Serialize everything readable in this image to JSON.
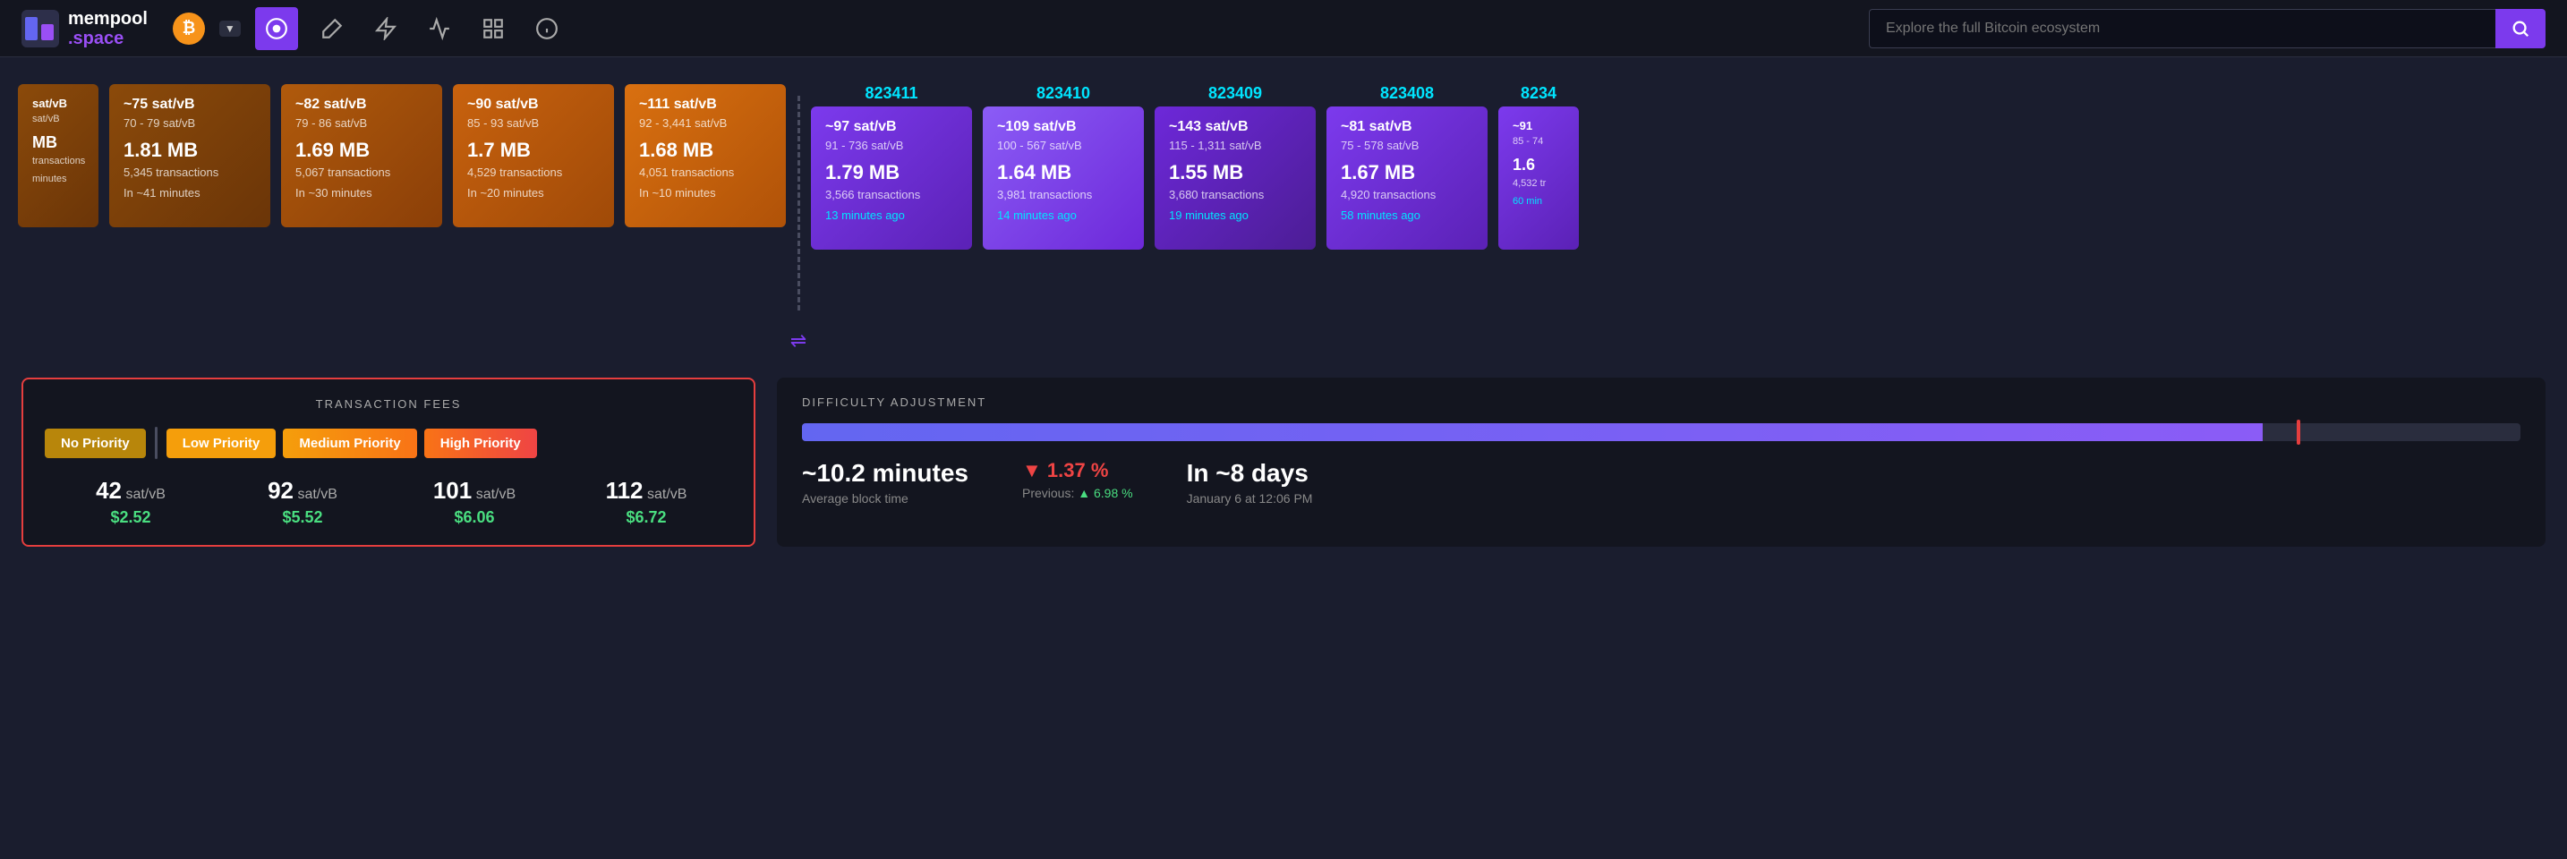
{
  "header": {
    "logo_mempool": "mempool",
    "logo_space": ".space",
    "bitcoin_symbol": "₿",
    "nav_icons": [
      "dashboard",
      "hammer",
      "lightning",
      "chart",
      "layers",
      "info"
    ],
    "search_placeholder": "Explore the full Bitcoin ecosystem",
    "search_button_icon": "🔍"
  },
  "mempool_blocks": [
    {
      "fee_top": "~75 sat/vB",
      "fee_range": "70 - 79 sat/vB",
      "size": "1.81 MB",
      "transactions": "5,345 transactions",
      "time": "In ~41 minutes",
      "color_class": "block-orange-dark"
    },
    {
      "fee_top": "~82 sat/vB",
      "fee_range": "79 - 86 sat/vB",
      "size": "1.69 MB",
      "transactions": "5,067 transactions",
      "time": "In ~30 minutes",
      "color_class": "block-orange-mid"
    },
    {
      "fee_top": "~90 sat/vB",
      "fee_range": "85 - 93 sat/vB",
      "size": "1.7 MB",
      "transactions": "4,529 transactions",
      "time": "In ~20 minutes",
      "color_class": "block-orange"
    },
    {
      "fee_top": "~111 sat/vB",
      "fee_range": "92 - 3,441 sat/vB",
      "size": "1.68 MB",
      "transactions": "4,051 transactions",
      "time": "In ~10 minutes",
      "color_class": "block-orange-bright"
    }
  ],
  "confirmed_blocks": [
    {
      "number": "823411",
      "fee_top": "~97 sat/vB",
      "fee_range": "91 - 736 sat/vB",
      "size": "1.79 MB",
      "transactions": "3,566 transactions",
      "time": "13 minutes ago",
      "color_class": "block-purple-bright"
    },
    {
      "number": "823410",
      "fee_top": "~109 sat/vB",
      "fee_range": "100 - 567 sat/vB",
      "size": "1.64 MB",
      "transactions": "3,981 transactions",
      "time": "14 minutes ago",
      "color_class": "block-purple-vivid"
    },
    {
      "number": "823409",
      "fee_top": "~143 sat/vB",
      "fee_range": "115 - 1,311 sat/vB",
      "size": "1.55 MB",
      "transactions": "3,680 transactions",
      "time": "19 minutes ago",
      "color_class": "block-purple-deep"
    },
    {
      "number": "823408",
      "fee_top": "~81 sat/vB",
      "fee_range": "75 - 578 sat/vB",
      "size": "1.67 MB",
      "transactions": "4,920 transactions",
      "time": "58 minutes ago",
      "color_class": "block-purple-mixed"
    },
    {
      "number": "8234",
      "fee_top": "~91",
      "fee_range": "85 - 74",
      "size": "1.6",
      "transactions": "4,532 tr",
      "time": "60 min",
      "color_class": "block-purple-mixed"
    }
  ],
  "transaction_fees": {
    "title": "TRANSACTION FEES",
    "no_priority_label": "No Priority",
    "low_priority_label": "Low Priority",
    "medium_priority_label": "Medium Priority",
    "high_priority_label": "High Priority",
    "no_priority_sat": "42",
    "low_priority_sat": "92",
    "medium_priority_sat": "101",
    "high_priority_sat": "112",
    "sat_unit": "sat/vB",
    "no_priority_usd": "$2.52",
    "low_priority_usd": "$5.52",
    "medium_priority_usd": "$6.06",
    "high_priority_usd": "$6.72"
  },
  "difficulty_adjustment": {
    "title": "DIFFICULTY ADJUSTMENT",
    "bar_fill_percent": 85,
    "bar_marker_percent": 87,
    "avg_block_time_value": "~10.2 minutes",
    "avg_block_time_label": "Average block time",
    "change_value": "1.37",
    "change_sign": "▼",
    "change_percent_symbol": "%",
    "change_label": "Previous:",
    "prev_change_value": "6.98",
    "prev_change_sign": "▲",
    "prev_change_percent": "%",
    "next_label": "In ~8 days",
    "next_date": "January 6 at 12:06 PM"
  }
}
